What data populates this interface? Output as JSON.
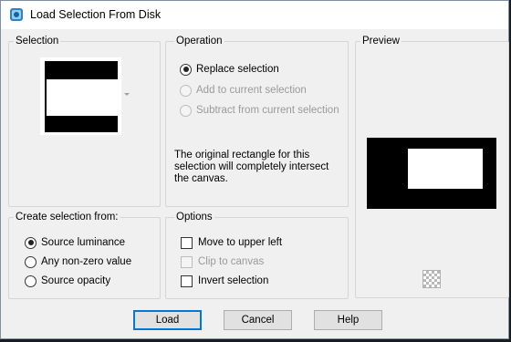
{
  "window": {
    "title": "Load Selection From Disk"
  },
  "selection_group": {
    "label": "Selection"
  },
  "operation_group": {
    "label": "Operation",
    "options": [
      {
        "label": "Replace selection",
        "checked": true,
        "enabled": true
      },
      {
        "label": "Add to current selection",
        "checked": false,
        "enabled": false
      },
      {
        "label": "Subtract from current selection",
        "checked": false,
        "enabled": false
      }
    ],
    "description": "The original rectangle for this selection will completely intersect the canvas."
  },
  "preview_group": {
    "label": "Preview"
  },
  "create_group": {
    "label": "Create selection from:",
    "options": [
      {
        "label": "Source luminance",
        "checked": true
      },
      {
        "label": "Any non-zero value",
        "checked": false
      },
      {
        "label": "Source opacity",
        "checked": false
      }
    ]
  },
  "options_group": {
    "label": "Options",
    "items": [
      {
        "label": "Move to upper left",
        "checked": false,
        "enabled": true
      },
      {
        "label": "Clip to canvas",
        "checked": false,
        "enabled": false
      },
      {
        "label": "Invert selection",
        "checked": false,
        "enabled": true
      }
    ]
  },
  "buttons": {
    "load": "Load",
    "cancel": "Cancel",
    "help": "Help"
  },
  "colors": {
    "accent": "#0078d7",
    "window_bg": "#f0f0f0"
  }
}
